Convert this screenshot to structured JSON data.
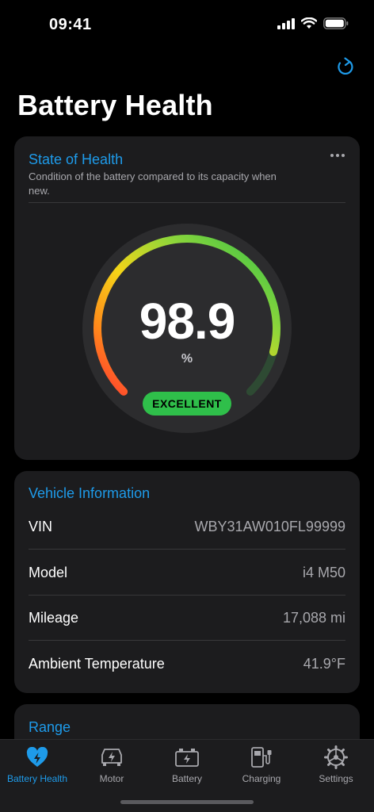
{
  "status_bar": {
    "time": "09:41",
    "icons": [
      "cellular-signal-icon",
      "wifi-icon",
      "battery-icon"
    ]
  },
  "header": {
    "title": "Battery Health",
    "refresh_icon": "refresh-icon"
  },
  "state_of_health": {
    "title": "State of Health",
    "description": "Condition of the battery compared to its capacity when new.",
    "value": "98.9",
    "unit": "%",
    "level_percent": 98.9,
    "rating": "EXCELLENT",
    "colors": {
      "accent": "#1e9bea",
      "good": "#2fbf4a",
      "mid": "#f5c518",
      "bad": "#ff3b30"
    }
  },
  "vehicle_information": {
    "title": "Vehicle Information",
    "rows": [
      {
        "label": "VIN",
        "value": "WBY31AW010FL99999"
      },
      {
        "label": "Model",
        "value": "i4 M50"
      },
      {
        "label": "Mileage",
        "value": "17,088 mi"
      },
      {
        "label": "Ambient Temperature",
        "value": "41.9°F"
      }
    ]
  },
  "range": {
    "title": "Range"
  },
  "tab_bar": {
    "active": "Battery Health",
    "tabs": [
      {
        "label": "Battery Health",
        "icon": "battery-health-heart-icon"
      },
      {
        "label": "Motor",
        "icon": "motor-icon"
      },
      {
        "label": "Battery",
        "icon": "battery-pack-icon"
      },
      {
        "label": "Charging",
        "icon": "charging-station-icon"
      },
      {
        "label": "Settings",
        "icon": "gear-icon"
      }
    ]
  }
}
